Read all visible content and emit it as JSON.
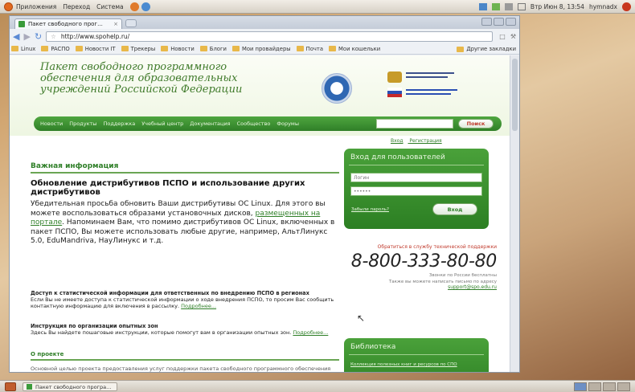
{
  "panel": {
    "menus": [
      "Приложения",
      "Переход",
      "Система"
    ],
    "tray_time": "Втр Июн  8, 13:54",
    "tray_user": "hymnadx"
  },
  "browser": {
    "tab_title": "Пакет свободного прог...",
    "tab_close": "×",
    "url": "http://www.spohelp.ru/",
    "bookmarks": [
      "Linux",
      "PACПО",
      "Новости IT",
      "Трекеры",
      "Новости",
      "Блоги",
      "Мои провайдеры",
      "Почта",
      "Мои кошельки"
    ],
    "other_bookmarks": "Другие закладки"
  },
  "site": {
    "title": "Пакет свободного программного обеспечения для образовательных учреждений Российской Федерации",
    "nav": [
      "Новости",
      "Продукты",
      "Поддержка",
      "Учебный центр",
      "Документация",
      "Сообщество",
      "Форумы"
    ],
    "search_button": "Поиск",
    "login_link": "Вход",
    "register_link": "Регистрация",
    "important_heading": "Важная информация",
    "article_title": "Обновление дистрибутивов ПСПО и использование других дистрибутивов",
    "article_text_1": "Убедительная просьба обновить Ваши дистрибутивы ОС Linux. Для этого вы можете воспользоваться образами установочных дисков,",
    "article_link": "размещенных на портале",
    "article_text_2": ". Напоминаем Вам, что помимо дистрибутивов ОС Linux, включенных в пакет ПСПО, Вы можете использовать любые другие, например, АльтЛинукс 5.0, EduMandriva, НауЛинукс и т.д.",
    "stats_title": "Доступ к статистической информации для ответственных по внедрению ПСПО в регионах",
    "stats_text": "Если Вы не имеете доступа к статистической информации о ходе внедрения ПСПО, то просим Вас сообщить контактную информацию для включения в рассылку.",
    "more_link": "Подробнее...",
    "trial_title": "Инструкция по организации опытных зон",
    "trial_text": "Здесь Вы найдете пошаговые инструкции, которые помогут вам в организации опытных зон.",
    "about_heading": "О проекте",
    "about_text": "Основной целью проекта предоставления услуг поддержки пакета свободного программного обеспечения"
  },
  "login": {
    "heading": "Вход для пользователей",
    "login_placeholder": "Логин",
    "password_value": "••••••",
    "forgot_link": "Забыли пароль?",
    "submit": "Вход"
  },
  "support": {
    "caption": "Обратиться в службу технической поддержки",
    "phone": "8-800-333-80-80",
    "free_note": "Звонки по России бесплатны",
    "email_note": "Также вы можете написать письмо по адресу",
    "email": "support@spo.edu.ru"
  },
  "library": {
    "heading": "Библиотека",
    "link": "Коллекция полезных книг и ресурсов по СПО"
  },
  "taskbar": {
    "task_title": "Пакет свободного програ..."
  },
  "colors": {
    "site_green": "#2f7f28",
    "accent_red": "#c0392b",
    "panel_orange": "#e2691f"
  }
}
